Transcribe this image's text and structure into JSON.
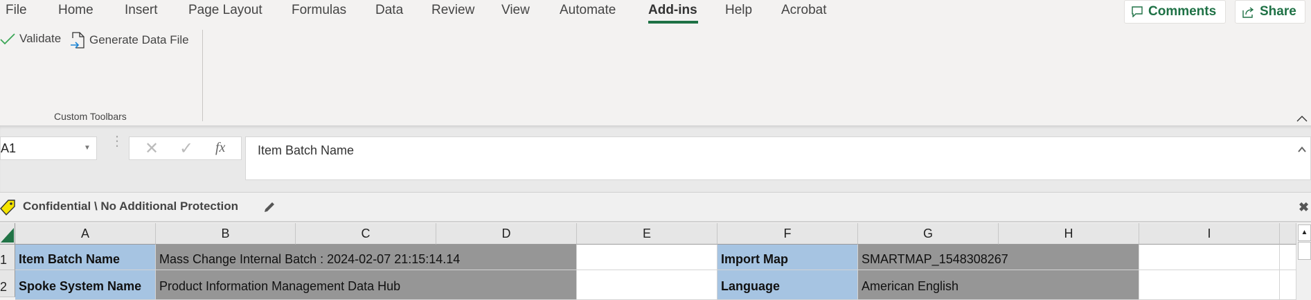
{
  "ribbon": {
    "tabs": [
      "File",
      "Home",
      "Insert",
      "Page Layout",
      "Formulas",
      "Data",
      "Review",
      "View",
      "Automate",
      "Add-ins",
      "Help",
      "Acrobat"
    ],
    "active_tab": "Add-ins",
    "comments_label": "Comments",
    "share_label": "Share",
    "buttons": {
      "validate": "Validate",
      "generate": "Generate Data File"
    },
    "group_label": "Custom Toolbars"
  },
  "formula_bar": {
    "name_box": "A1",
    "fx": "fx",
    "content": "Item Batch Name"
  },
  "sensitivity": {
    "label": "Confidential \\ No Additional Protection"
  },
  "sheet": {
    "columns": [
      "A",
      "B",
      "C",
      "D",
      "E",
      "F",
      "G",
      "H",
      "I"
    ],
    "rows": [
      "1",
      "2"
    ],
    "cells": {
      "A1": "Item Batch Name",
      "B1": "Mass Change Internal Batch : 2024-02-07 21:15:14.14",
      "F1": "Import Map",
      "G1": "SMARTMAP_1548308267",
      "A2": "Spoke System Name",
      "B2": "Product Information Management Data Hub",
      "F2": "Language",
      "G2": "American English"
    },
    "colors": {
      "label_fill": "#a6c4e2",
      "value_fill": "#969696",
      "accent": "#1e7145"
    }
  }
}
